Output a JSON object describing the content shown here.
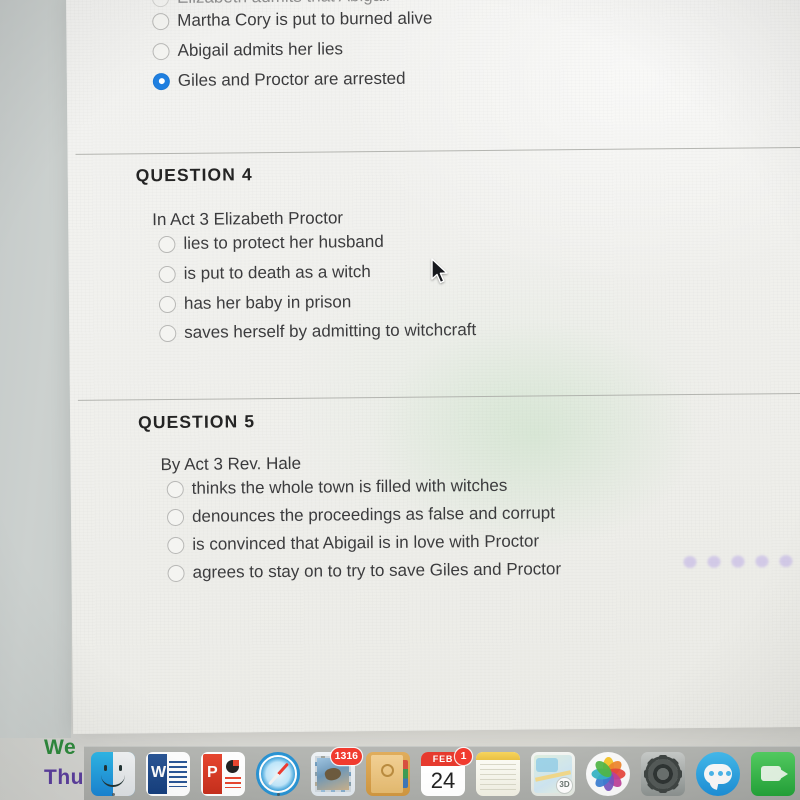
{
  "page": {
    "previous_question_options": [
      {
        "label": "Elizabeth admits that Abigail",
        "selected": false,
        "clipped": true
      },
      {
        "label": "Martha Cory is put to burned alive",
        "selected": false
      },
      {
        "label": "Abigail admits her lies",
        "selected": false
      },
      {
        "label": "Giles and Proctor are arrested",
        "selected": true
      }
    ],
    "questions": [
      {
        "heading": "QUESTION 4",
        "stem": "In Act 3 Elizabeth Proctor",
        "options": [
          {
            "label": "lies to protect her husband",
            "selected": false
          },
          {
            "label": "is put to death as a witch",
            "selected": false
          },
          {
            "label": "has her baby in prison",
            "selected": false
          },
          {
            "label": "saves herself by admitting to witchcraft",
            "selected": false
          }
        ]
      },
      {
        "heading": "QUESTION 5",
        "stem": "By Act 3 Rev. Hale",
        "options": [
          {
            "label": "thinks the whole town is filled with witches",
            "selected": false
          },
          {
            "label": "denounces the proceedings as false and corrupt",
            "selected": false
          },
          {
            "label": "is convinced that Abigail is in love with Proctor",
            "selected": false
          },
          {
            "label": "agrees to stay on to try to save Giles and Proctor",
            "selected": false
          }
        ]
      }
    ]
  },
  "desktop": {
    "text_line_1": "We",
    "text_line_2": "Thu",
    "text_color_1": "#2f8a3d",
    "text_color_2": "#5c3f9e"
  },
  "dock": {
    "items": [
      {
        "name": "finder",
        "label": "Finder",
        "badge": "",
        "running": true
      },
      {
        "name": "word",
        "label": "Microsoft Word",
        "badge": "",
        "running": false
      },
      {
        "name": "powerpoint",
        "label": "Microsoft PowerPoint",
        "badge": "",
        "running": false
      },
      {
        "name": "safari",
        "label": "Safari",
        "badge": "",
        "running": true
      },
      {
        "name": "mail",
        "label": "Mail",
        "badge": "1316",
        "running": false
      },
      {
        "name": "contacts",
        "label": "Contacts",
        "badge": "",
        "running": false
      },
      {
        "name": "calendar",
        "label": "Calendar",
        "badge": "1",
        "running": false,
        "month": "FEB",
        "day": "24"
      },
      {
        "name": "notes",
        "label": "Notes",
        "badge": "",
        "running": false
      },
      {
        "name": "maps",
        "label": "Maps",
        "badge": "",
        "running": false,
        "badge_3d": "3D"
      },
      {
        "name": "photos",
        "label": "Photos",
        "badge": "",
        "running": false
      },
      {
        "name": "system-preferences",
        "label": "System Preferences",
        "badge": "",
        "running": false
      },
      {
        "name": "messages",
        "label": "Messages",
        "badge": "",
        "running": false
      },
      {
        "name": "facetime",
        "label": "FaceTime",
        "badge": "",
        "running": false
      }
    ]
  },
  "colors": {
    "selected_radio": "#1f7fe0",
    "radio_border": "#b8b8b6",
    "text": "#3c3c3e",
    "heading": "#242424",
    "divider": "#a9aaa6",
    "page_background": "#f1f1ee",
    "badge_red": "#f13b2f"
  }
}
